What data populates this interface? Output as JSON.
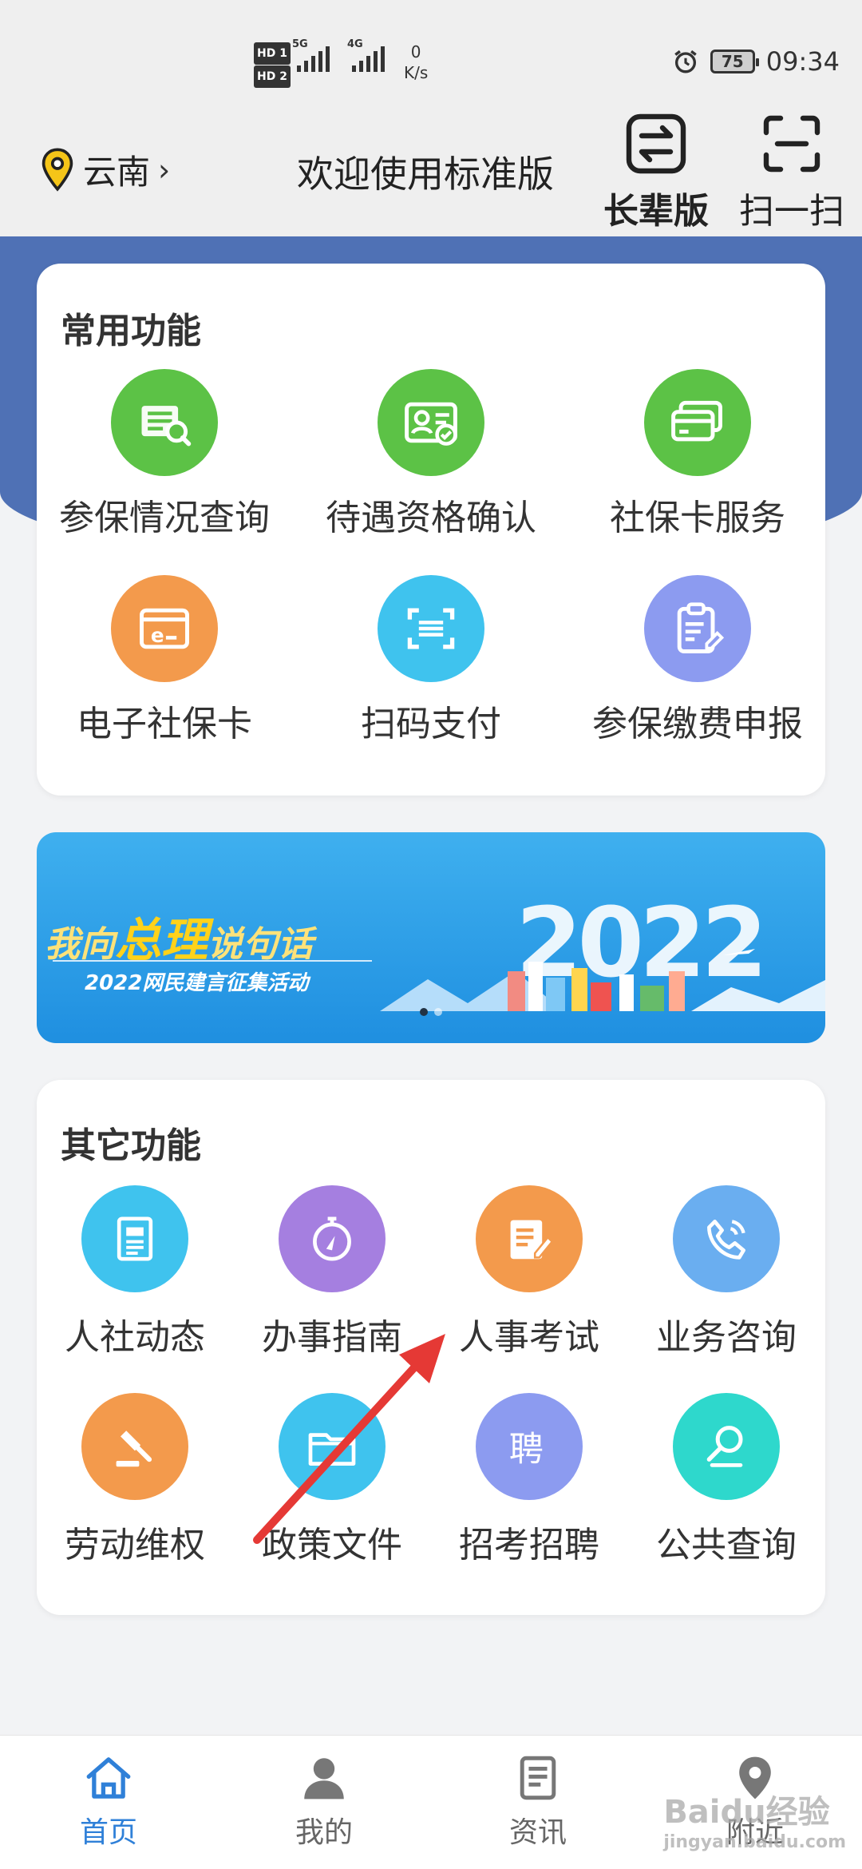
{
  "status_bar": {
    "sim1": "HD 1",
    "sim2": "HD 2",
    "net1": "5G",
    "net2": "4G",
    "speed_value": "0",
    "speed_unit": "K/s",
    "battery": "75",
    "time": "09:34"
  },
  "header": {
    "location": "云南",
    "location_chevron": "›",
    "welcome": "欢迎使用标准版",
    "elder_label": "长辈版",
    "scan_label": "扫一扫"
  },
  "common": {
    "title": "常用功能",
    "items": [
      {
        "label": "参保情况查询",
        "color": "#5cc246",
        "icon": "document-search-icon"
      },
      {
        "label": "待遇资格确认",
        "color": "#5cc246",
        "icon": "id-card-check-icon"
      },
      {
        "label": "社保卡服务",
        "color": "#5cc246",
        "icon": "card-stack-icon"
      },
      {
        "label": "电子社保卡",
        "color": "#f39a4c",
        "icon": "e-card-icon"
      },
      {
        "label": "扫码支付",
        "color": "#3fc3ee",
        "icon": "scan-pay-icon"
      },
      {
        "label": "参保缴费申报",
        "color": "#8c9bf0",
        "icon": "clipboard-edit-icon"
      }
    ]
  },
  "banner": {
    "line_a": "我向",
    "line_b": "总理",
    "line_c": "说句话",
    "sub": "2022网民建言征集活动",
    "year": "2022"
  },
  "other": {
    "title": "其它功能",
    "items": [
      {
        "label": "人社动态",
        "color": "#3fc3ee",
        "icon": "news-icon"
      },
      {
        "label": "办事指南",
        "color": "#a57fe0",
        "icon": "compass-icon"
      },
      {
        "label": "人事考试",
        "color": "#f39a4c",
        "icon": "exam-edit-icon"
      },
      {
        "label": "业务咨询",
        "color": "#6aaef0",
        "icon": "phone-icon"
      },
      {
        "label": "劳动维权",
        "color": "#f39a4c",
        "icon": "gavel-icon"
      },
      {
        "label": "政策文件",
        "color": "#3fc3ee",
        "icon": "folder-icon"
      },
      {
        "label": "招考招聘",
        "color": "#8c9bf0",
        "icon": "hire-icon"
      },
      {
        "label": "公共查询",
        "color": "#2ed8cc",
        "icon": "search-icon"
      }
    ]
  },
  "tabs": [
    {
      "label": "首页",
      "icon": "home-icon",
      "active": true
    },
    {
      "label": "我的",
      "icon": "user-icon",
      "active": false
    },
    {
      "label": "资讯",
      "icon": "news-doc-icon",
      "active": false
    },
    {
      "label": "附近",
      "icon": "location-icon",
      "active": false
    }
  ],
  "watermark": {
    "text": "Baidu经验",
    "sub": "jingyan.baidu.com"
  },
  "colors": {
    "accent": "#2f80d8",
    "header_blue": "#4f71b5",
    "arrow": "#e53935"
  }
}
